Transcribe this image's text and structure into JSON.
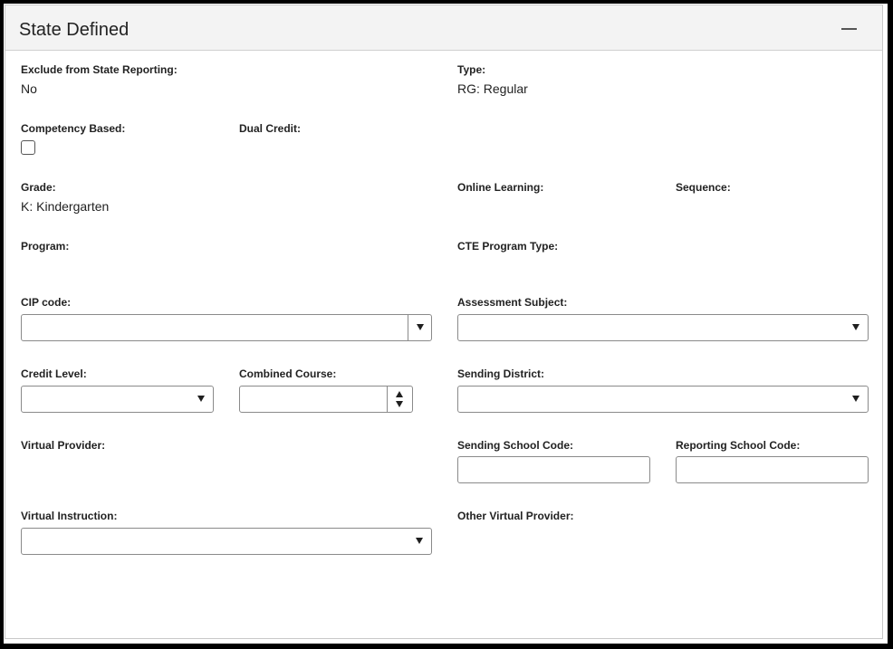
{
  "panel": {
    "title": "State Defined",
    "collapse_icon": "minus-icon"
  },
  "fields": {
    "exclude_from_state_reporting": {
      "label": "Exclude from State Reporting:",
      "value": "No"
    },
    "type": {
      "label": "Type:",
      "value": "RG: Regular"
    },
    "competency_based": {
      "label": "Competency Based:",
      "checked": false
    },
    "dual_credit": {
      "label": "Dual Credit:"
    },
    "grade": {
      "label": "Grade:",
      "value": "K: Kindergarten"
    },
    "online_learning": {
      "label": "Online Learning:"
    },
    "sequence": {
      "label": "Sequence:"
    },
    "program": {
      "label": "Program:"
    },
    "cte_program_type": {
      "label": "CTE Program Type:"
    },
    "cip_code": {
      "label": "CIP code:",
      "value": ""
    },
    "assessment_subject": {
      "label": "Assessment Subject:",
      "value": ""
    },
    "credit_level": {
      "label": "Credit Level:",
      "value": ""
    },
    "combined_course": {
      "label": "Combined Course:",
      "value": ""
    },
    "sending_district": {
      "label": "Sending District:",
      "value": ""
    },
    "virtual_provider": {
      "label": "Virtual Provider:"
    },
    "sending_school_code": {
      "label": "Sending School Code:",
      "value": ""
    },
    "reporting_school_code": {
      "label": "Reporting School Code:",
      "value": ""
    },
    "virtual_instruction": {
      "label": "Virtual Instruction:",
      "value": ""
    },
    "other_virtual_provider": {
      "label": "Other Virtual Provider:"
    }
  }
}
